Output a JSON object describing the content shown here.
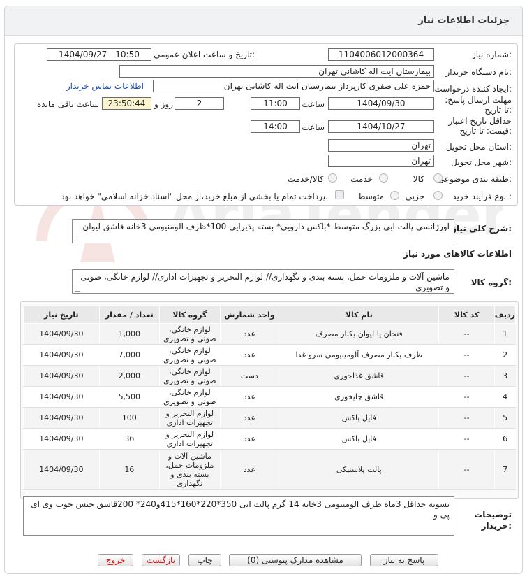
{
  "header": {
    "title": "جزئیات اطلاعات نیاز"
  },
  "fields": {
    "need_number_label": "شماره نیاز:",
    "need_number": "1104006012000364",
    "announce_label": "تاریخ و ساعت اعلان عمومی:",
    "announce_value": "1404/09/27 - 10:50",
    "buyer_label": "نام دستگاه خریدار:",
    "buyer_value": "بیمارستان ایت اله کاشانی تهران",
    "creator_label": "ایجاد کننده درخواست:",
    "creator_value": "حمزه علی صفری کارپرداز بیمارستان ایت اله کاشانی تهران",
    "contact_link": "اطلاعات تماس خریدار",
    "deadline_label": "مهلت ارسال پاسخ: تا تاریخ:",
    "deadline_date": "1404/09/30",
    "time_word": "ساعت",
    "deadline_time": "11:00",
    "days_value": "2",
    "days_word": "روز و",
    "remaining_time": "23:50:44",
    "remaining_word": "ساعت باقی مانده",
    "validity_label": "حداقل تاریخ اعتبار قیمت: تا تاریخ:",
    "validity_date": "1404/10/27",
    "validity_time": "14:00",
    "province_label": "استان محل تحویل:",
    "province_value": "تهران",
    "city_label": "شهر محل تحویل:",
    "city_value": "تهران",
    "category_label": "طبقه بندی موضوعی:",
    "category_options": [
      "کالا",
      "خدمت",
      "کالا/خدمت"
    ],
    "process_label": "نوع فرآیند خرید :",
    "process_options": [
      "جزیی",
      "متوسط"
    ],
    "payment_note": "پرداخت تمام یا بخشی از مبلغ خرید،از محل \"اسناد خزانه اسلامی\" خواهد بود."
  },
  "summary": {
    "label": "شرح کلی نیاز:",
    "text": "اورژانسی پالت ابی بزرگ متوسط *باکس دارویی* بسته پذیرایی 100*ظرف الومنیومی 3خانه  قاشق لیوان"
  },
  "goods_info_title": "اطلاعات کالاهای مورد نیاز",
  "goods_group": {
    "label": "گروه کالا:",
    "text": "ماشین آلات و ملزومات حمل، بسته بندی و نگهداری// لوازم التحریر و تجهیزات اداری// لوازم خانگی، صوتی و تصویری"
  },
  "table": {
    "headers": [
      "ردیف",
      "کد کالا",
      "نام کالا",
      "واحد شمارش",
      "گروه کالا",
      "تعداد / مقدار",
      "تاریخ نیاز"
    ],
    "rows": [
      {
        "row": "1",
        "code": "--",
        "name": "فنجان یا لیوان یکبار مصرف",
        "unit": "عدد",
        "group": "لوازم خانگی، صوتی و تصویری",
        "qty": "1,000",
        "date": "1404/09/30"
      },
      {
        "row": "2",
        "code": "--",
        "name": "ظرف یکبار مصرف آلومینیومی سرو غذا",
        "unit": "عدد",
        "group": "لوازم خانگی، صوتی و تصویری",
        "qty": "7,000",
        "date": "1404/09/30"
      },
      {
        "row": "3",
        "code": "--",
        "name": "قاشق غذاخوری",
        "unit": "دست",
        "group": "لوازم خانگی، صوتی و تصویری",
        "qty": "2,000",
        "date": "1404/09/30"
      },
      {
        "row": "4",
        "code": "--",
        "name": "قاشق چایخوری",
        "unit": "عدد",
        "group": "لوازم خانگی، صوتی و تصویری",
        "qty": "5,500",
        "date": "1404/09/30"
      },
      {
        "row": "5",
        "code": "--",
        "name": "فایل باکس",
        "unit": "عدد",
        "group": "لوازم التحریر و تجهیزات اداری",
        "qty": "100",
        "date": "1404/09/30"
      },
      {
        "row": "6",
        "code": "--",
        "name": "فایل باکس",
        "unit": "عدد",
        "group": "لوازم التحریر و تجهیزات اداری",
        "qty": "36",
        "date": "1404/09/30"
      },
      {
        "row": "7",
        "code": "--",
        "name": "پالت پلاستیکی",
        "unit": "عدد",
        "group": "ماشین آلات و ملزومات حمل، بسته بندی و نگهداری",
        "qty": "16",
        "date": "1404/09/30"
      }
    ]
  },
  "buyer_notes": {
    "label": "توضیحات خریدار:",
    "text": "تسویه حداقل 3ماه ظرف الومنیومی 3خانه 14 گرم پالت ابی 350*220*160*415و240* 200قاشق جنس خوب وی ای پی و"
  },
  "buttons": {
    "reply": "پاسخ به نیاز",
    "view_docs": "مشاهده مدارک پیوستی (0)",
    "print": "چاپ",
    "back": "بازگشت",
    "exit": "خروج"
  },
  "watermark": {
    "text": "AriaTender.neT"
  },
  "colors": {
    "link": "#1a4fb5",
    "remaining_bg": "#fbf6cf",
    "exit_text": "#dd1111"
  }
}
